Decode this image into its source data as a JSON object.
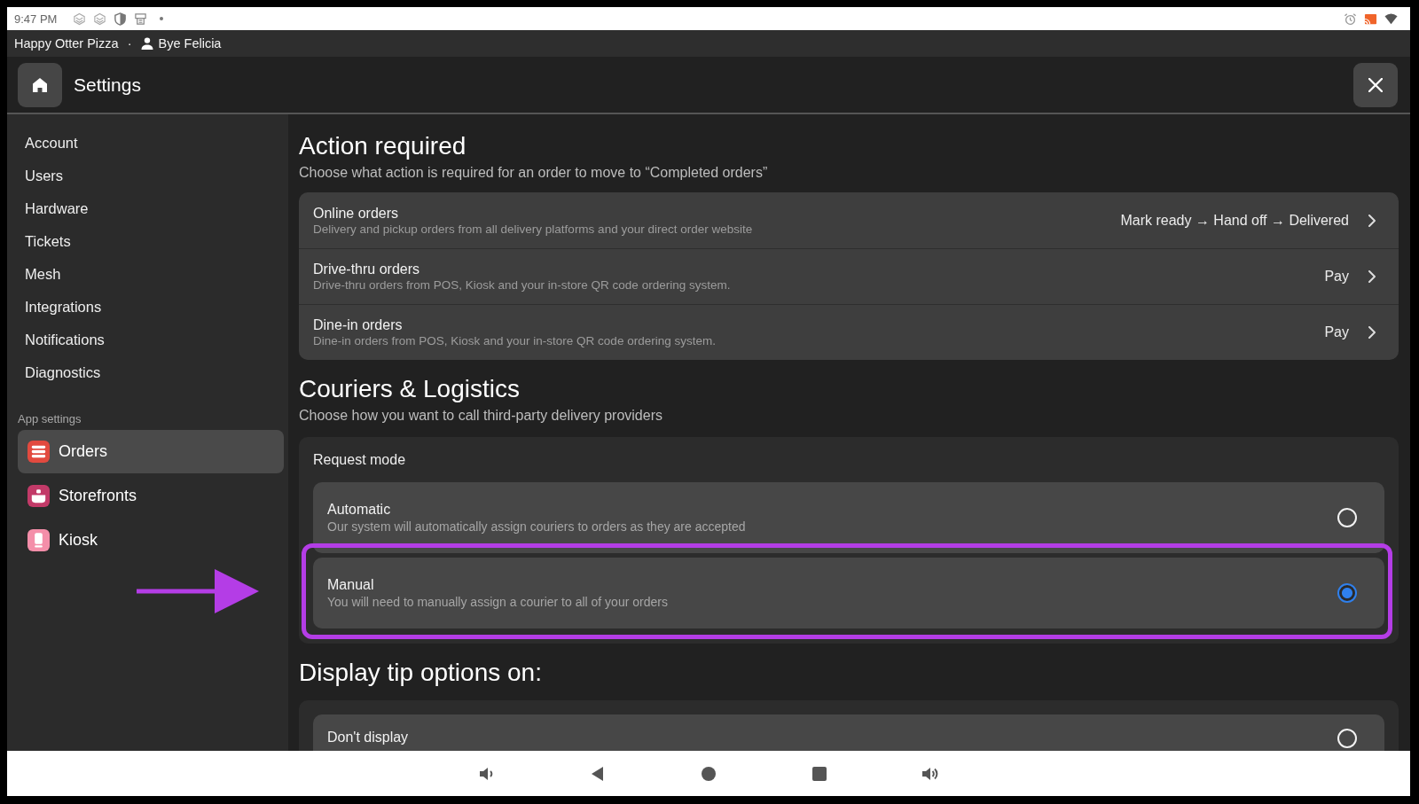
{
  "status_bar": {
    "time": "9:47 PM"
  },
  "account_bar": {
    "business": "Happy Otter Pizza",
    "separator": "·",
    "user": "Bye Felicia"
  },
  "header": {
    "title": "Settings"
  },
  "sidebar": {
    "items": [
      {
        "label": "Account",
        "selected": false
      },
      {
        "label": "Users",
        "selected": false
      },
      {
        "label": "Hardware",
        "selected": false
      },
      {
        "label": "Tickets",
        "selected": false
      },
      {
        "label": "Mesh",
        "selected": false
      },
      {
        "label": "Integrations",
        "selected": false
      },
      {
        "label": "Notifications",
        "selected": false
      },
      {
        "label": "Diagnostics",
        "selected": false
      }
    ],
    "section_label": "App settings",
    "app_items": [
      {
        "label": "Orders",
        "selected": true,
        "color": "#e24a3f"
      },
      {
        "label": "Storefronts",
        "selected": false,
        "color": "#c23a68"
      },
      {
        "label": "Kiosk",
        "selected": false,
        "color": "#f48ea9"
      }
    ]
  },
  "sections": [
    {
      "kind": "list",
      "title": "Action required",
      "subtitle": "Choose what action is required for an order to move to “Completed orders”",
      "rows": [
        {
          "title": "Online orders",
          "description": "Delivery and pickup orders from all delivery platforms and your direct order website",
          "value": "Mark ready → Hand off → Delivered"
        },
        {
          "title": "Drive-thru orders",
          "description": "Drive-thru orders from POS, Kiosk and your in-store QR code ordering system.",
          "value": "Pay"
        },
        {
          "title": "Dine-in orders",
          "description": "Dine-in orders from POS, Kiosk and your in-store QR code ordering system.",
          "value": "Pay"
        }
      ]
    },
    {
      "kind": "choice",
      "title": "Couriers & Logistics",
      "subtitle": "Choose how you want to call third-party delivery providers",
      "group_label": "Request mode",
      "options": [
        {
          "title": "Automatic",
          "description": "Our system will automatically assign couriers to orders as they are accepted",
          "selected": false,
          "highlighted": false
        },
        {
          "title": "Manual",
          "description": "You will need to manually assign a courier to all of your orders",
          "selected": true,
          "highlighted": true
        }
      ]
    },
    {
      "kind": "choice",
      "title": "Display tip options on:",
      "options": [
        {
          "title": "Don't display",
          "selected": false,
          "highlighted": false
        }
      ]
    }
  ]
}
